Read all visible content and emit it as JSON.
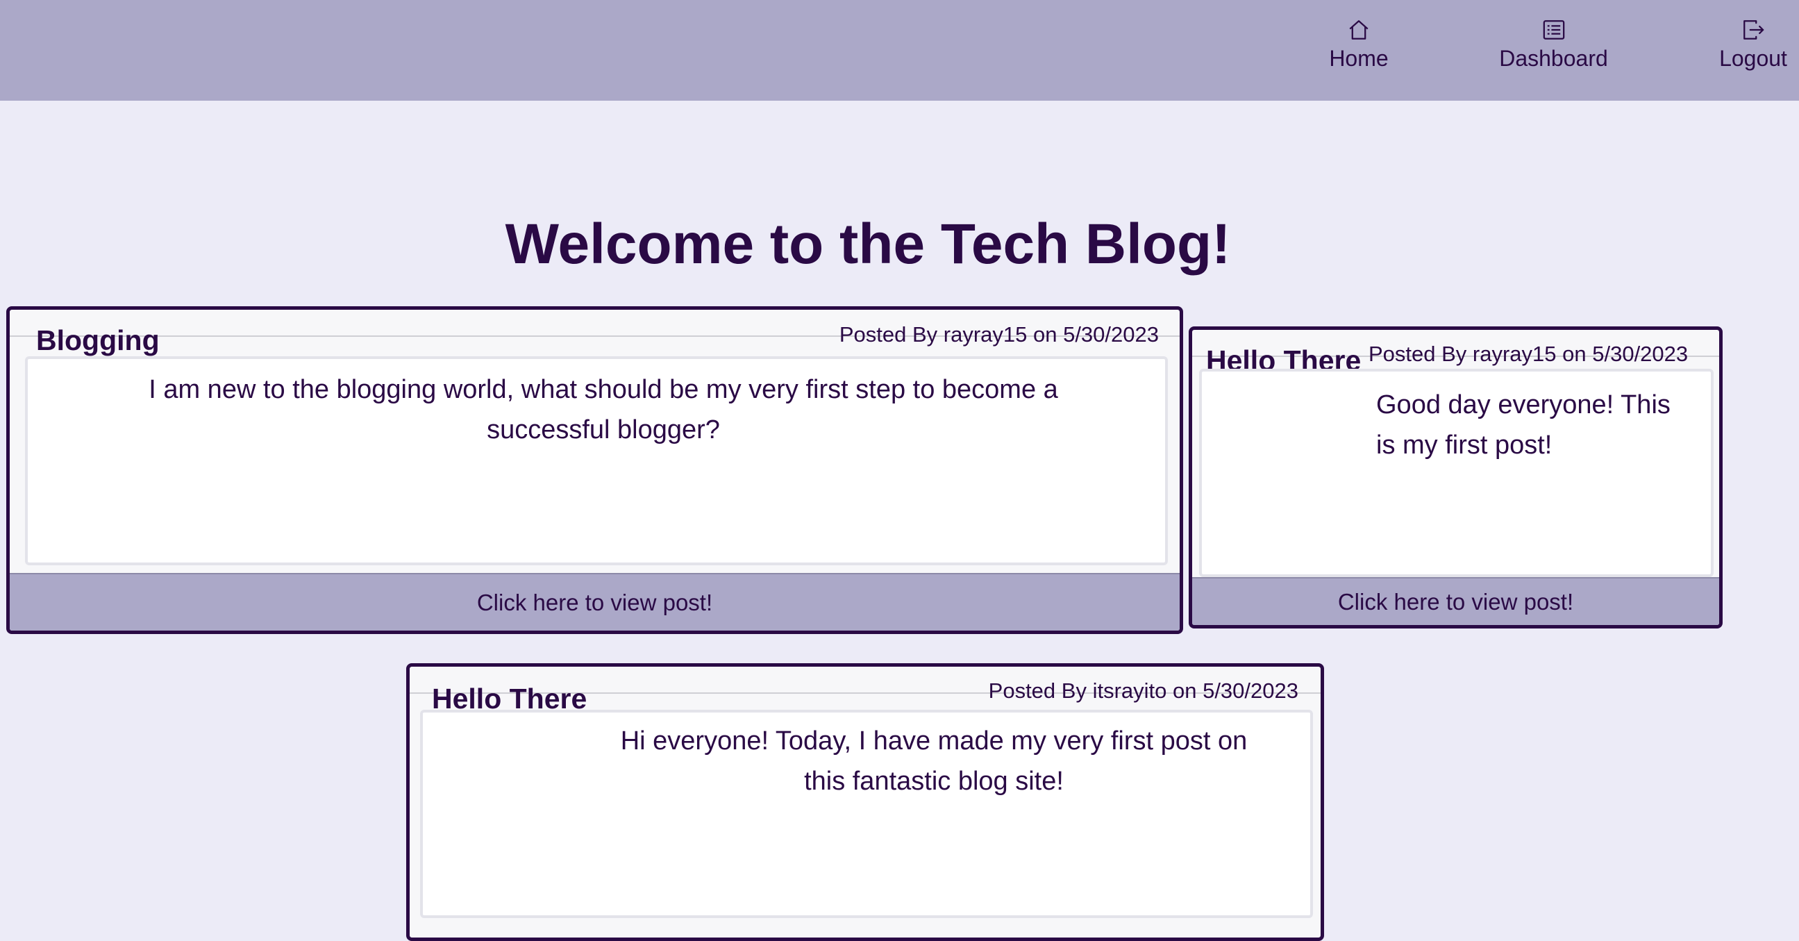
{
  "nav": {
    "home_label": "Home",
    "dashboard_label": "Dashboard",
    "logout_label": "Logout"
  },
  "page": {
    "title": "Welcome to the Tech Blog!"
  },
  "posts": [
    {
      "title": "Blogging",
      "meta": "Posted By rayray15 on 5/30/2023",
      "content": "I am new to the blogging world, what should be my very first step to become a successful blogger?",
      "link_label": "Click here to view post!"
    },
    {
      "title": "Hello There",
      "meta": "Posted By rayray15 on 5/30/2023",
      "content": "Good day everyone! This is my first post!",
      "link_label": "Click here to view post!"
    },
    {
      "title": "Hello There",
      "meta": "Posted By itsrayito on 5/30/2023",
      "content": "Hi everyone! Today, I have made my very first post on this fantastic blog site!"
    }
  ],
  "colors": {
    "navbar_bg": "#aba8c8",
    "page_bg": "#ecebf7",
    "text": "#2a0a45",
    "card_border": "#2a0a45"
  },
  "icons": {
    "home": "home-icon",
    "dashboard": "list-icon",
    "logout": "logout-icon"
  }
}
